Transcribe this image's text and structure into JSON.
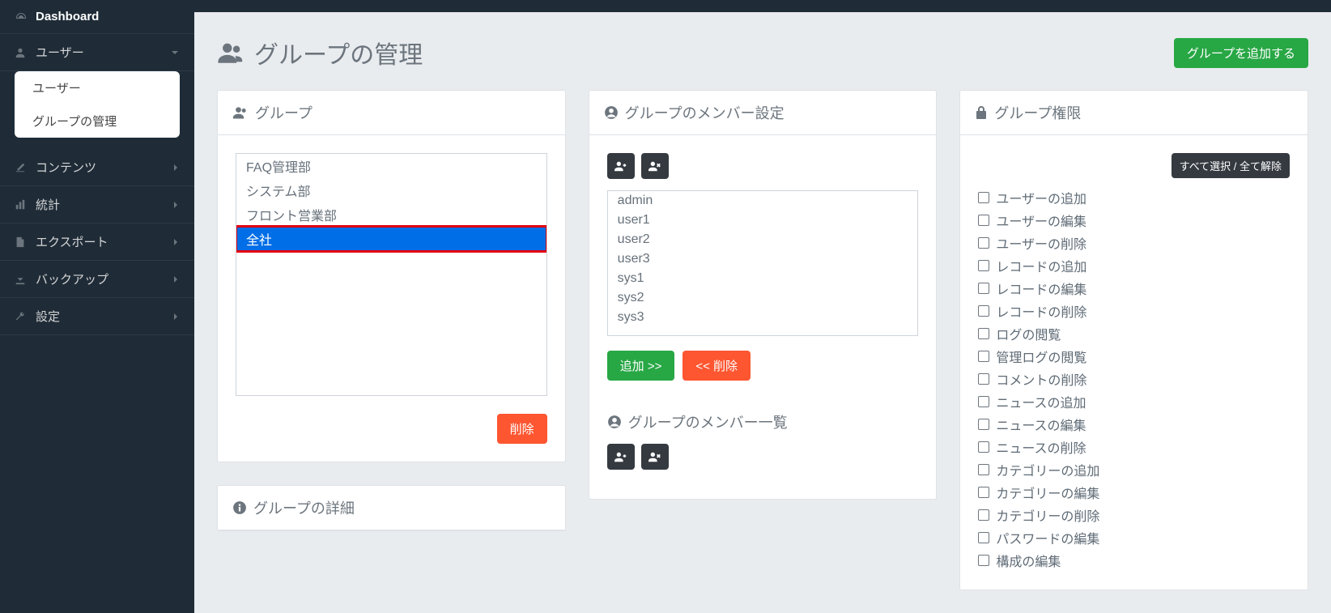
{
  "sidebar": {
    "dashboard": "Dashboard",
    "items": [
      {
        "label": "ユーザー",
        "expanded": true,
        "sub": [
          "ユーザー",
          "グループの管理"
        ]
      },
      {
        "label": "コンテンツ"
      },
      {
        "label": "統計"
      },
      {
        "label": "エクスポート"
      },
      {
        "label": "バックアップ"
      },
      {
        "label": "設定"
      }
    ]
  },
  "page": {
    "title": "グループの管理",
    "add_group": "グループを追加する"
  },
  "groups_panel": {
    "title": "グループ",
    "items": [
      "FAQ管理部",
      "システム部",
      "フロント営業部",
      "全社"
    ],
    "selected_index": 3,
    "delete": "削除"
  },
  "details_panel": {
    "title": "グループの詳細"
  },
  "members_panel": {
    "title": "グループのメンバー設定",
    "users": [
      "admin",
      "user1",
      "user2",
      "user3",
      "sys1",
      "sys2",
      "sys3"
    ],
    "add": "追加 >>",
    "remove": "<< 削除",
    "list_title": "グループのメンバー一覧"
  },
  "perms_panel": {
    "title": "グループ権限",
    "toggle_all": "すべて選択 / 全て解除",
    "items": [
      "ユーザーの追加",
      "ユーザーの編集",
      "ユーザーの削除",
      "レコードの追加",
      "レコードの編集",
      "レコードの削除",
      "ログの閲覧",
      "管理ログの閲覧",
      "コメントの削除",
      "ニュースの追加",
      "ニュースの編集",
      "ニュースの削除",
      "カテゴリーの追加",
      "カテゴリーの編集",
      "カテゴリーの削除",
      "パスワードの編集",
      "構成の編集"
    ]
  }
}
